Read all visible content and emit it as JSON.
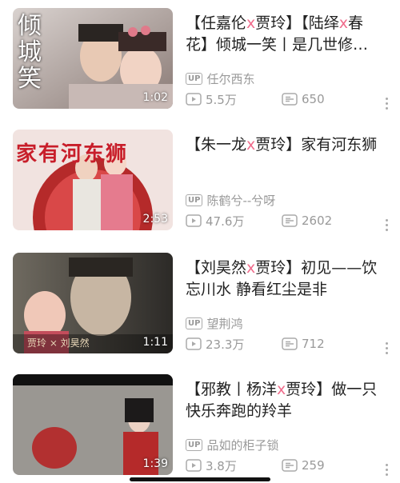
{
  "videos": [
    {
      "title_parts": [
        "【任嘉伦",
        "x",
        "贾玲】【陆绎",
        "x",
        "春花】倾城一笑丨是几世修来…"
      ],
      "duration": "1:02",
      "uploader": "任尔西东",
      "views": "5.5万",
      "comments": "650",
      "thumb_text": "倾城笑"
    },
    {
      "title_parts": [
        "【朱一龙",
        "x",
        "贾玲】家有河东狮"
      ],
      "duration": "2:53",
      "uploader": "陈鹤兮--兮呀",
      "views": "47.6万",
      "comments": "2602",
      "thumb_text": "家有河东狮"
    },
    {
      "title_parts": [
        "【刘昊然",
        "x",
        "贾玲】初见——饮忘川水 静看红尘是非"
      ],
      "duration": "1:11",
      "uploader": "望荆鸿",
      "views": "23.3万",
      "comments": "712",
      "thumb_text": "贾玲 × 刘昊然"
    },
    {
      "title_parts": [
        "【邪教丨杨洋",
        "x",
        "贾玲】做一只快乐奔跑的羚羊"
      ],
      "duration": "1:39",
      "uploader": "品如的柜子锁",
      "views": "3.8万",
      "comments": "259",
      "thumb_text": ""
    }
  ],
  "up_badge_label": "UP",
  "colors": {
    "accent": "#f06c8c",
    "meta": "#999999"
  }
}
